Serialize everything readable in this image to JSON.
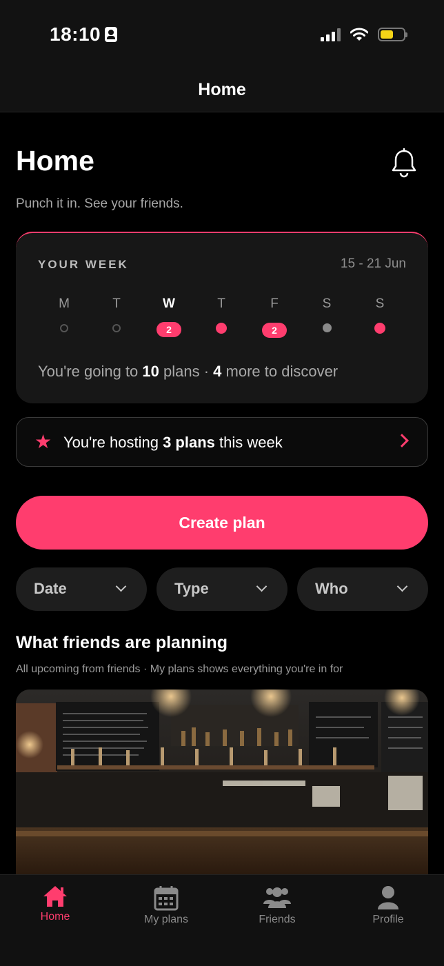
{
  "status": {
    "time": "18:10"
  },
  "nav": {
    "title": "Home"
  },
  "header": {
    "title": "Home",
    "subtitle": "Punch it in. See your friends."
  },
  "week": {
    "label": "YOUR WEEK",
    "range": "15 - 21 Jun",
    "days": [
      {
        "label": "M",
        "mark": "empty"
      },
      {
        "label": "T",
        "mark": "empty"
      },
      {
        "label": "W",
        "mark": "count",
        "count": "2",
        "today": true
      },
      {
        "label": "T",
        "mark": "dot"
      },
      {
        "label": "F",
        "mark": "count",
        "count": "2"
      },
      {
        "label": "S",
        "mark": "grey-dot"
      },
      {
        "label": "S",
        "mark": "dot"
      }
    ],
    "summary": {
      "pre": "You're going to ",
      "going": "10",
      "mid": " plans · ",
      "discover": "4",
      "post": " more to discover"
    }
  },
  "hosting": {
    "pre": "You're hosting ",
    "bold": "3 plans",
    "post": " this week"
  },
  "create_label": "Create plan",
  "filters": [
    "Date",
    "Type",
    "Who"
  ],
  "friends": {
    "title": "What friends are planning",
    "subtitle": "All upcoming from friends · My plans shows everything you're in for"
  },
  "tabs": [
    {
      "label": "Home",
      "icon": "home-icon",
      "active": true
    },
    {
      "label": "My plans",
      "icon": "calendar-icon",
      "active": false
    },
    {
      "label": "Friends",
      "icon": "friends-icon",
      "active": false
    },
    {
      "label": "Profile",
      "icon": "profile-icon",
      "active": false
    }
  ],
  "colors": {
    "accent": "#ff3d6e",
    "background": "#000000",
    "card": "#171717"
  }
}
